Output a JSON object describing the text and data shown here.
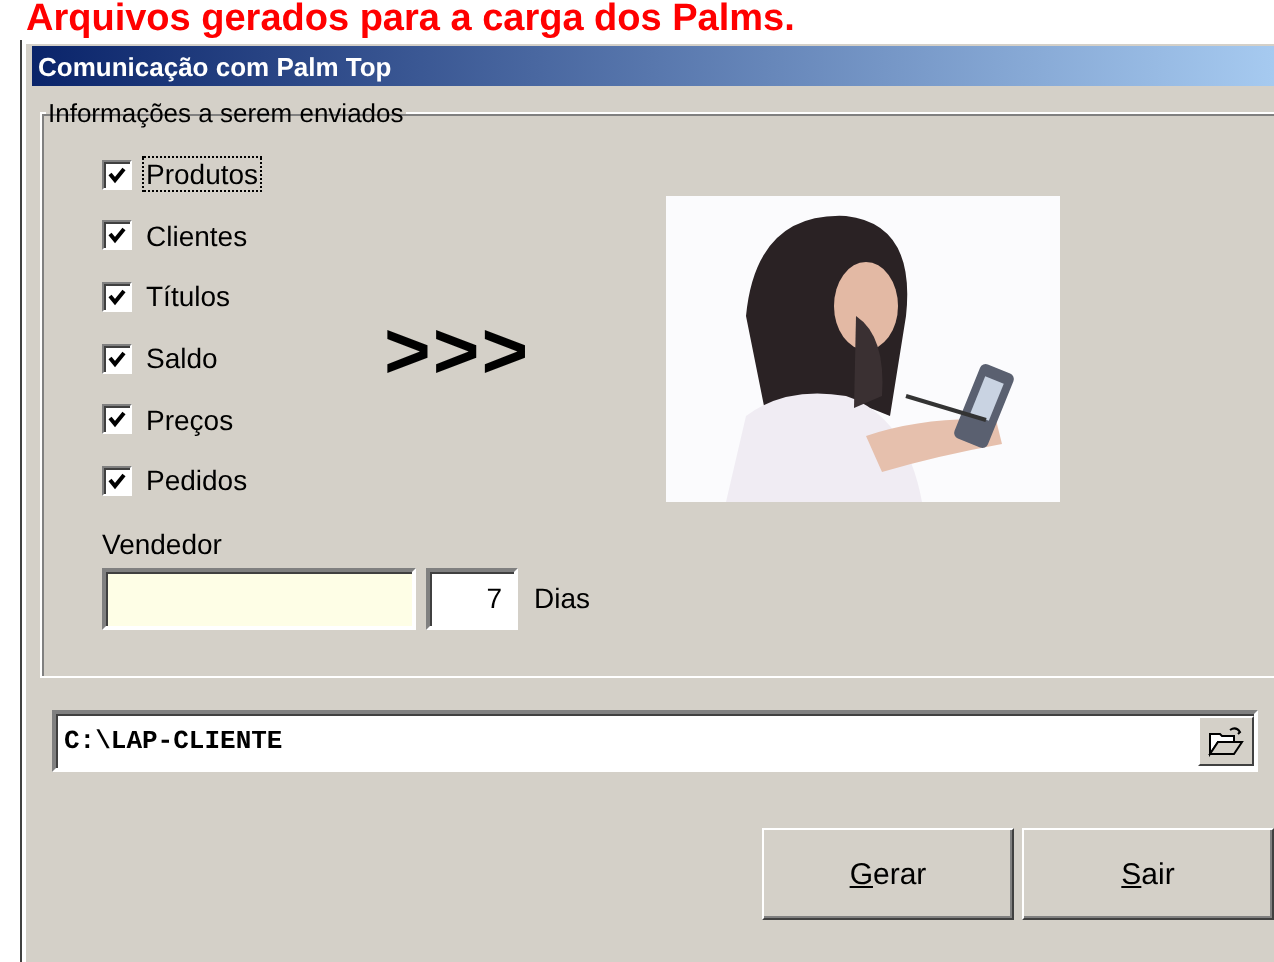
{
  "heading": "Arquivos gerados para a carga dos Palms.",
  "window": {
    "title": "Comunicação com Palm Top"
  },
  "group": {
    "title": "Informações a serem enviados",
    "options": [
      {
        "label": "Produtos",
        "checked": true,
        "focused": true
      },
      {
        "label": "Clientes",
        "checked": true,
        "focused": false
      },
      {
        "label": "Títulos",
        "checked": true,
        "focused": false
      },
      {
        "label": "Saldo",
        "checked": true,
        "focused": false
      },
      {
        "label": "Preços",
        "checked": true,
        "focused": false
      },
      {
        "label": "Pedidos",
        "checked": true,
        "focused": false
      }
    ],
    "arrows": ">>>",
    "seller_label": "Vendedor",
    "days_value": "7",
    "days_label": "Dias"
  },
  "path_field": {
    "value": "C:\\LAP-CLIENTE"
  },
  "buttons": [
    {
      "label": "Gerar"
    },
    {
      "label": "Sair"
    }
  ]
}
